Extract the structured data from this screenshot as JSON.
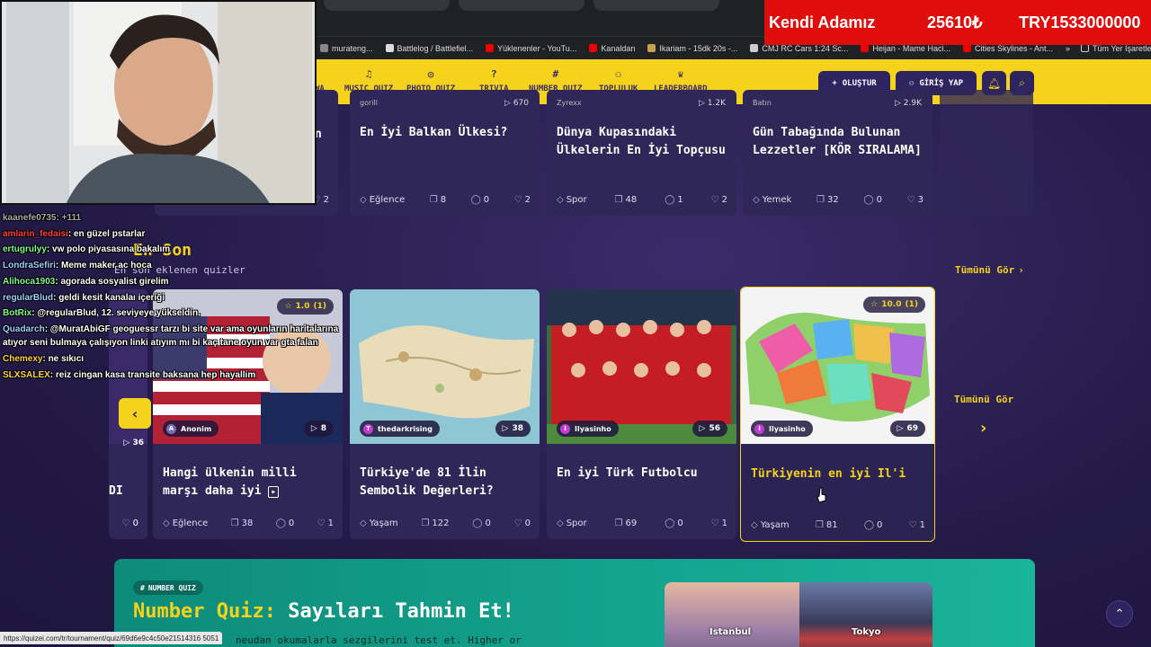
{
  "ticker": {
    "name": "Kendi Adamız",
    "amount": "25610₺",
    "currency": "TRY1533000000"
  },
  "bookmarks": [
    "murateng...",
    "Battlelog / Battlefiel...",
    "Yüklenenler - YouTu...",
    "Kanaldan",
    "Ikariam - 15dk 20s -...",
    "CMJ RC Cars 1:24 Sc...",
    "Heijan - Mame Haci...",
    "Cities Skylines - Ant...",
    "»",
    "Tüm Yer İşaretleri"
  ],
  "nav": {
    "items": [
      {
        "icon": "♫",
        "label": "MUSIC QUIZ"
      },
      {
        "icon": "◎",
        "label": "PHOTO QUIZ"
      },
      {
        "icon": "?",
        "label": "TRIVIA"
      },
      {
        "icon": "#",
        "label": "NUMBER QUIZ"
      },
      {
        "icon": "⚇",
        "label": "TOPLULUK"
      },
      {
        "icon": "♛",
        "label": "LEADERBOARD"
      }
    ],
    "partial": "WA",
    "create": "OLUŞTUR",
    "login": "GİRİŞ YAP"
  },
  "top_cards": [
    {
      "partial_title": "n",
      "likes": "2"
    },
    {
      "author": "gorill",
      "plays": "670",
      "title": "En İyi Balkan Ülkesi?",
      "category": "Eğlence",
      "questions": "8",
      "comments": "0",
      "likes": "2"
    },
    {
      "author": "Zyrexx",
      "plays": "1.2K",
      "title": "Dünya Kupasındaki Ülkelerin En İyi Topçusu",
      "category": "Spor",
      "questions": "48",
      "comments": "1",
      "likes": "2"
    },
    {
      "author": "Batın",
      "plays": "2.9K",
      "title": "Gün Tabağında Bulunan Lezzetler [KÖR SIRALAMA]",
      "category": "Yemek",
      "questions": "32",
      "comments": "0",
      "likes": "3"
    }
  ],
  "section": {
    "title": "En Son",
    "subtitle": "En son eklenen quizler",
    "see_all": "Tümünü Gör"
  },
  "cards": [
    {
      "plays": "36",
      "title": "DI",
      "likes": "0"
    },
    {
      "rating": "1.0",
      "rating_count": "(1)",
      "author": "Anonim",
      "plays": "8",
      "title": "Hangi ülkenin milli marşı daha iyi",
      "category": "Eğlence",
      "questions": "38",
      "comments": "0",
      "likes": "1"
    },
    {
      "author": "thedarkrising",
      "plays": "38",
      "title": "Türkiye'de 81 İlin Sembolik Değerleri?",
      "category": "Yaşam",
      "questions": "122",
      "comments": "0",
      "likes": "0"
    },
    {
      "author": "Ilyasinho",
      "plays": "56",
      "title": "En iyi Türk Futbolcu",
      "category": "Spor",
      "questions": "69",
      "comments": "0",
      "likes": "1"
    },
    {
      "rating": "10.0",
      "rating_count": "(1)",
      "author": "Ilyasinho",
      "plays": "69",
      "title": "Türkiyenin en iyi Il'i",
      "category": "Yaşam",
      "questions": "81",
      "comments": "0",
      "likes": "1"
    }
  ],
  "side_see_all": "Tümünü Gör",
  "chat": [
    {
      "user": "kaanefe0735",
      "text": ": +111",
      "color": "#aaaaaa"
    },
    {
      "user": "amlarin_fedaisi",
      "text": ": en güzel pstarlar",
      "color": "#ff3b3b"
    },
    {
      "user": "ertugrulyy",
      "text": ": vw polo piyasasına bakalım",
      "color": "#7cfc8a"
    },
    {
      "user": "LondraSefiri",
      "text": ": Meme maker ac hoca",
      "color": "#9ad0ff"
    },
    {
      "user": "Alihoca1903",
      "text": ": agorada sosyalist girelim",
      "color": "#7cfc8a"
    },
    {
      "user": "regularBlud",
      "text": ": geldi kesit kanalaı içeriği",
      "color": "#9ad0ff"
    },
    {
      "user": "BotRix",
      "text": ": @regularBlud, 12. seviyeye yükseldin.",
      "color": "#7cfc8a"
    },
    {
      "user": "Quadarch",
      "text": ": @MuratAbiGF geoguessr tarzı bi site var ama oyunların haritalarına",
      "color": "#9ad0ff"
    },
    {
      "user": "",
      "text": "atıyor seni bulmaya çalışıyon linki atıyım mı bi kaç tane oyun var gta falan",
      "color": "#ffffff"
    },
    {
      "user": "Chemexy",
      "text": ": ne sıkıcı",
      "color": "#ffd23a"
    },
    {
      "user": "SLXSALEX",
      "text": ": reiz cingan kasa transite baksana hep hayallim",
      "color": "#ffd23a"
    }
  ],
  "number_quiz": {
    "tag": "NUMBER QUIZ",
    "title_prefix": "Number Quiz:",
    "title_main": "Sayıları Tahmin Et!",
    "desc": "neudan okumalarla sezgilerini test et. Higher or",
    "cities": [
      "Istanbul",
      "Tokyo"
    ]
  },
  "status_url": "https://quizei.com/tr/tournament/quiz/69d6e9c4c50e21514316 5051",
  "colors": {
    "accent": "#f5d21c",
    "card": "#2f2757",
    "banner": "#13a58f",
    "ticker": "#e00d0d"
  }
}
